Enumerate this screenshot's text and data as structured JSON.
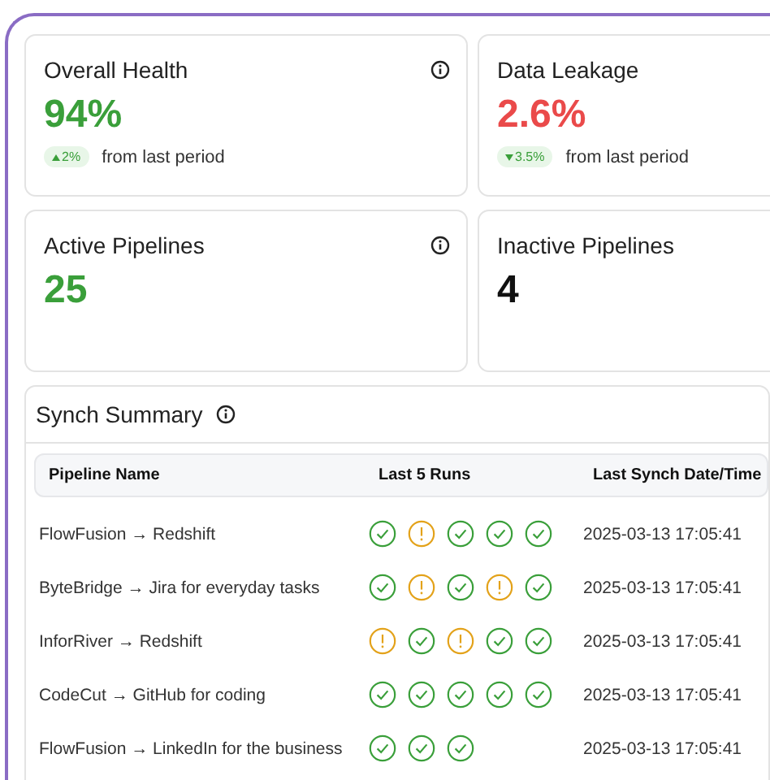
{
  "cards": [
    {
      "title": "Overall Health",
      "value": "94%",
      "color": "#3a9f3a",
      "info": true,
      "delta": {
        "text": "2%",
        "rising": true,
        "note": "from last period"
      }
    },
    {
      "title": "Data Leakage",
      "value": "2.6%",
      "color": "#ea4a4a",
      "info": false,
      "delta": {
        "text": "3.5%",
        "rising": false,
        "note": "from last period"
      }
    },
    {
      "title": "Active Pipelines",
      "value": "25",
      "color": "#3a9f3a",
      "info": true
    },
    {
      "title": "Inactive Pipelines",
      "value": "4",
      "color": "#111111",
      "info": false
    }
  ],
  "synch_summary": {
    "title": "Synch Summary",
    "columns": [
      "Pipeline Name",
      "Last 5 Runs",
      "Last Synch Date/Time"
    ],
    "rows": [
      {
        "name": "FlowFusion → Redshift",
        "runs": [
          {
            "warning": false
          },
          {
            "warning": true
          },
          {
            "warning": false
          },
          {
            "warning": false
          },
          {
            "warning": false
          }
        ],
        "time": "2025-03-13 17:05:41"
      },
      {
        "name": "ByteBridge → Jira for everyday tasks",
        "runs": [
          {
            "warning": false
          },
          {
            "warning": true
          },
          {
            "warning": false
          },
          {
            "warning": true
          },
          {
            "warning": false
          }
        ],
        "time": "2025-03-13 17:05:41"
      },
      {
        "name": "InforRiver → Redshift",
        "runs": [
          {
            "warning": true
          },
          {
            "warning": false
          },
          {
            "warning": true
          },
          {
            "warning": false
          },
          {
            "warning": false
          }
        ],
        "time": "2025-03-13 17:05:41"
      },
      {
        "name": "CodeCut → GitHub for coding",
        "runs": [
          {
            "warning": false
          },
          {
            "warning": false
          },
          {
            "warning": false
          },
          {
            "warning": false
          },
          {
            "warning": false
          }
        ],
        "time": "2025-03-13 17:05:41"
      },
      {
        "name": "FlowFusion → LinkedIn for the business",
        "runs": [
          {
            "warning": false
          },
          {
            "warning": false
          },
          {
            "warning": false
          }
        ],
        "time": "2025-03-13 17:05:41"
      }
    ]
  }
}
